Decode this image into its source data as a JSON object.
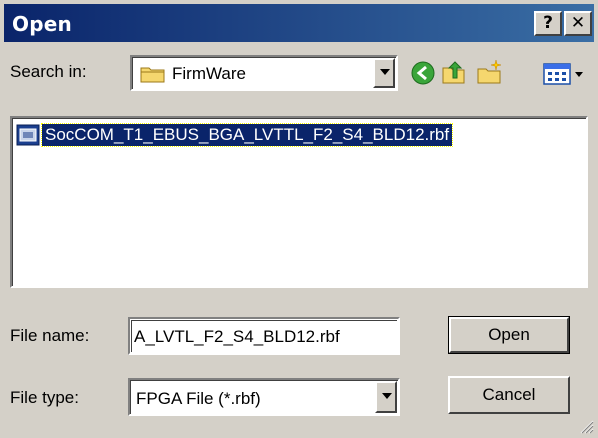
{
  "window": {
    "title": "Open",
    "help_label": "?",
    "close_label": "✕"
  },
  "search": {
    "label": "Search in:",
    "folder": "FirmWare",
    "folder_icon": "folder-icon",
    "toolbar": [
      "back-icon",
      "up-folder-icon",
      "new-folder-icon",
      "views-menu-icon"
    ]
  },
  "files": [
    {
      "name": "SocCOM_T1_EBUS_BGA_LVTTL_F2_S4_BLD12.rbf",
      "icon": "rbf-file-icon",
      "selected": true
    }
  ],
  "form": {
    "filename_label": "File name:",
    "filename_value": "A_LVTL_F2_S4_BLD12.rbf",
    "filetype_label": "File type:",
    "filetype_value": "FPGA File (*.rbf)"
  },
  "buttons": {
    "open": "Open",
    "cancel": "Cancel"
  },
  "colors": {
    "title_start": "#0a246a",
    "title_end": "#3a6ea5",
    "face": "#d4d0c8",
    "selection": "#0a246a"
  }
}
